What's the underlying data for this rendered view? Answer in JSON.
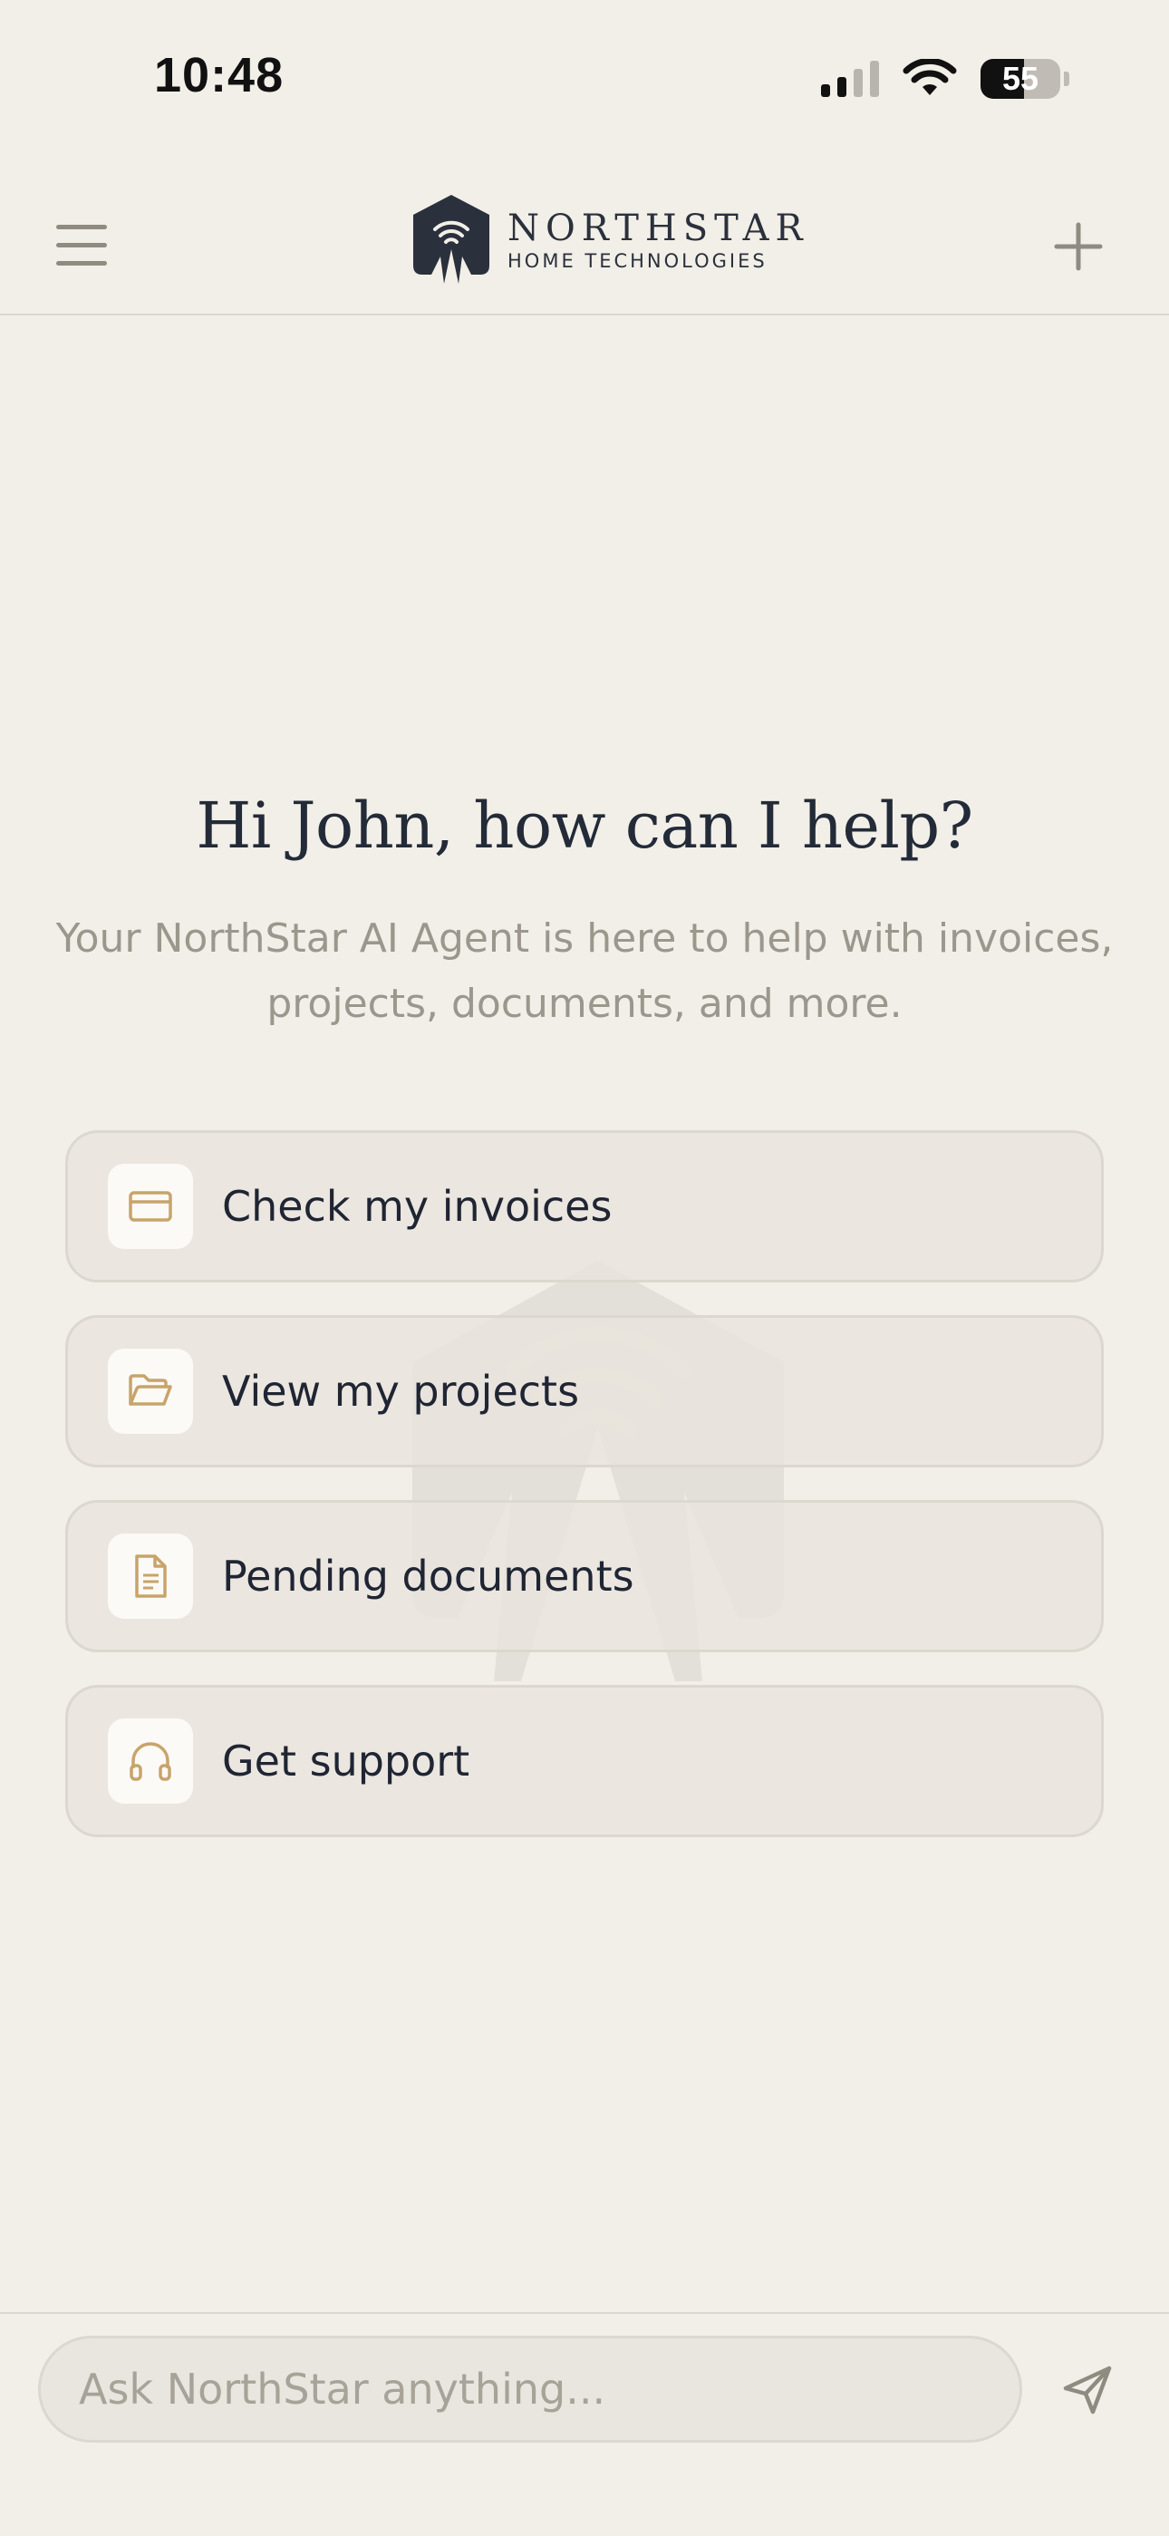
{
  "status_bar": {
    "time": "10:48",
    "battery_level": "55"
  },
  "header": {
    "brand_name": "NORTHSTAR",
    "brand_tagline": "HOME TECHNOLOGIES",
    "menu_icon": "hamburger-menu-icon",
    "new_icon": "plus-icon"
  },
  "welcome": {
    "greeting": "Hi John, how can I help?",
    "subtitle": "Your NorthStar AI Agent is here to help with invoices, projects, documents, and more."
  },
  "quick_actions": [
    {
      "label": "Check my invoices",
      "icon": "credit-card-icon"
    },
    {
      "label": "View my projects",
      "icon": "folder-open-icon"
    },
    {
      "label": "Pending documents",
      "icon": "document-icon"
    },
    {
      "label": "Get support",
      "icon": "headphones-icon"
    }
  ],
  "composer": {
    "placeholder": "Ask NorthStar anything...",
    "send_icon": "send-icon"
  },
  "colors": {
    "background": "#f2efe8",
    "accent_gold": "#c8a46a",
    "text_dark": "#1f2533",
    "text_muted": "#9c978c",
    "card_bg": "#e9e6df",
    "border": "#dcd8cf"
  }
}
